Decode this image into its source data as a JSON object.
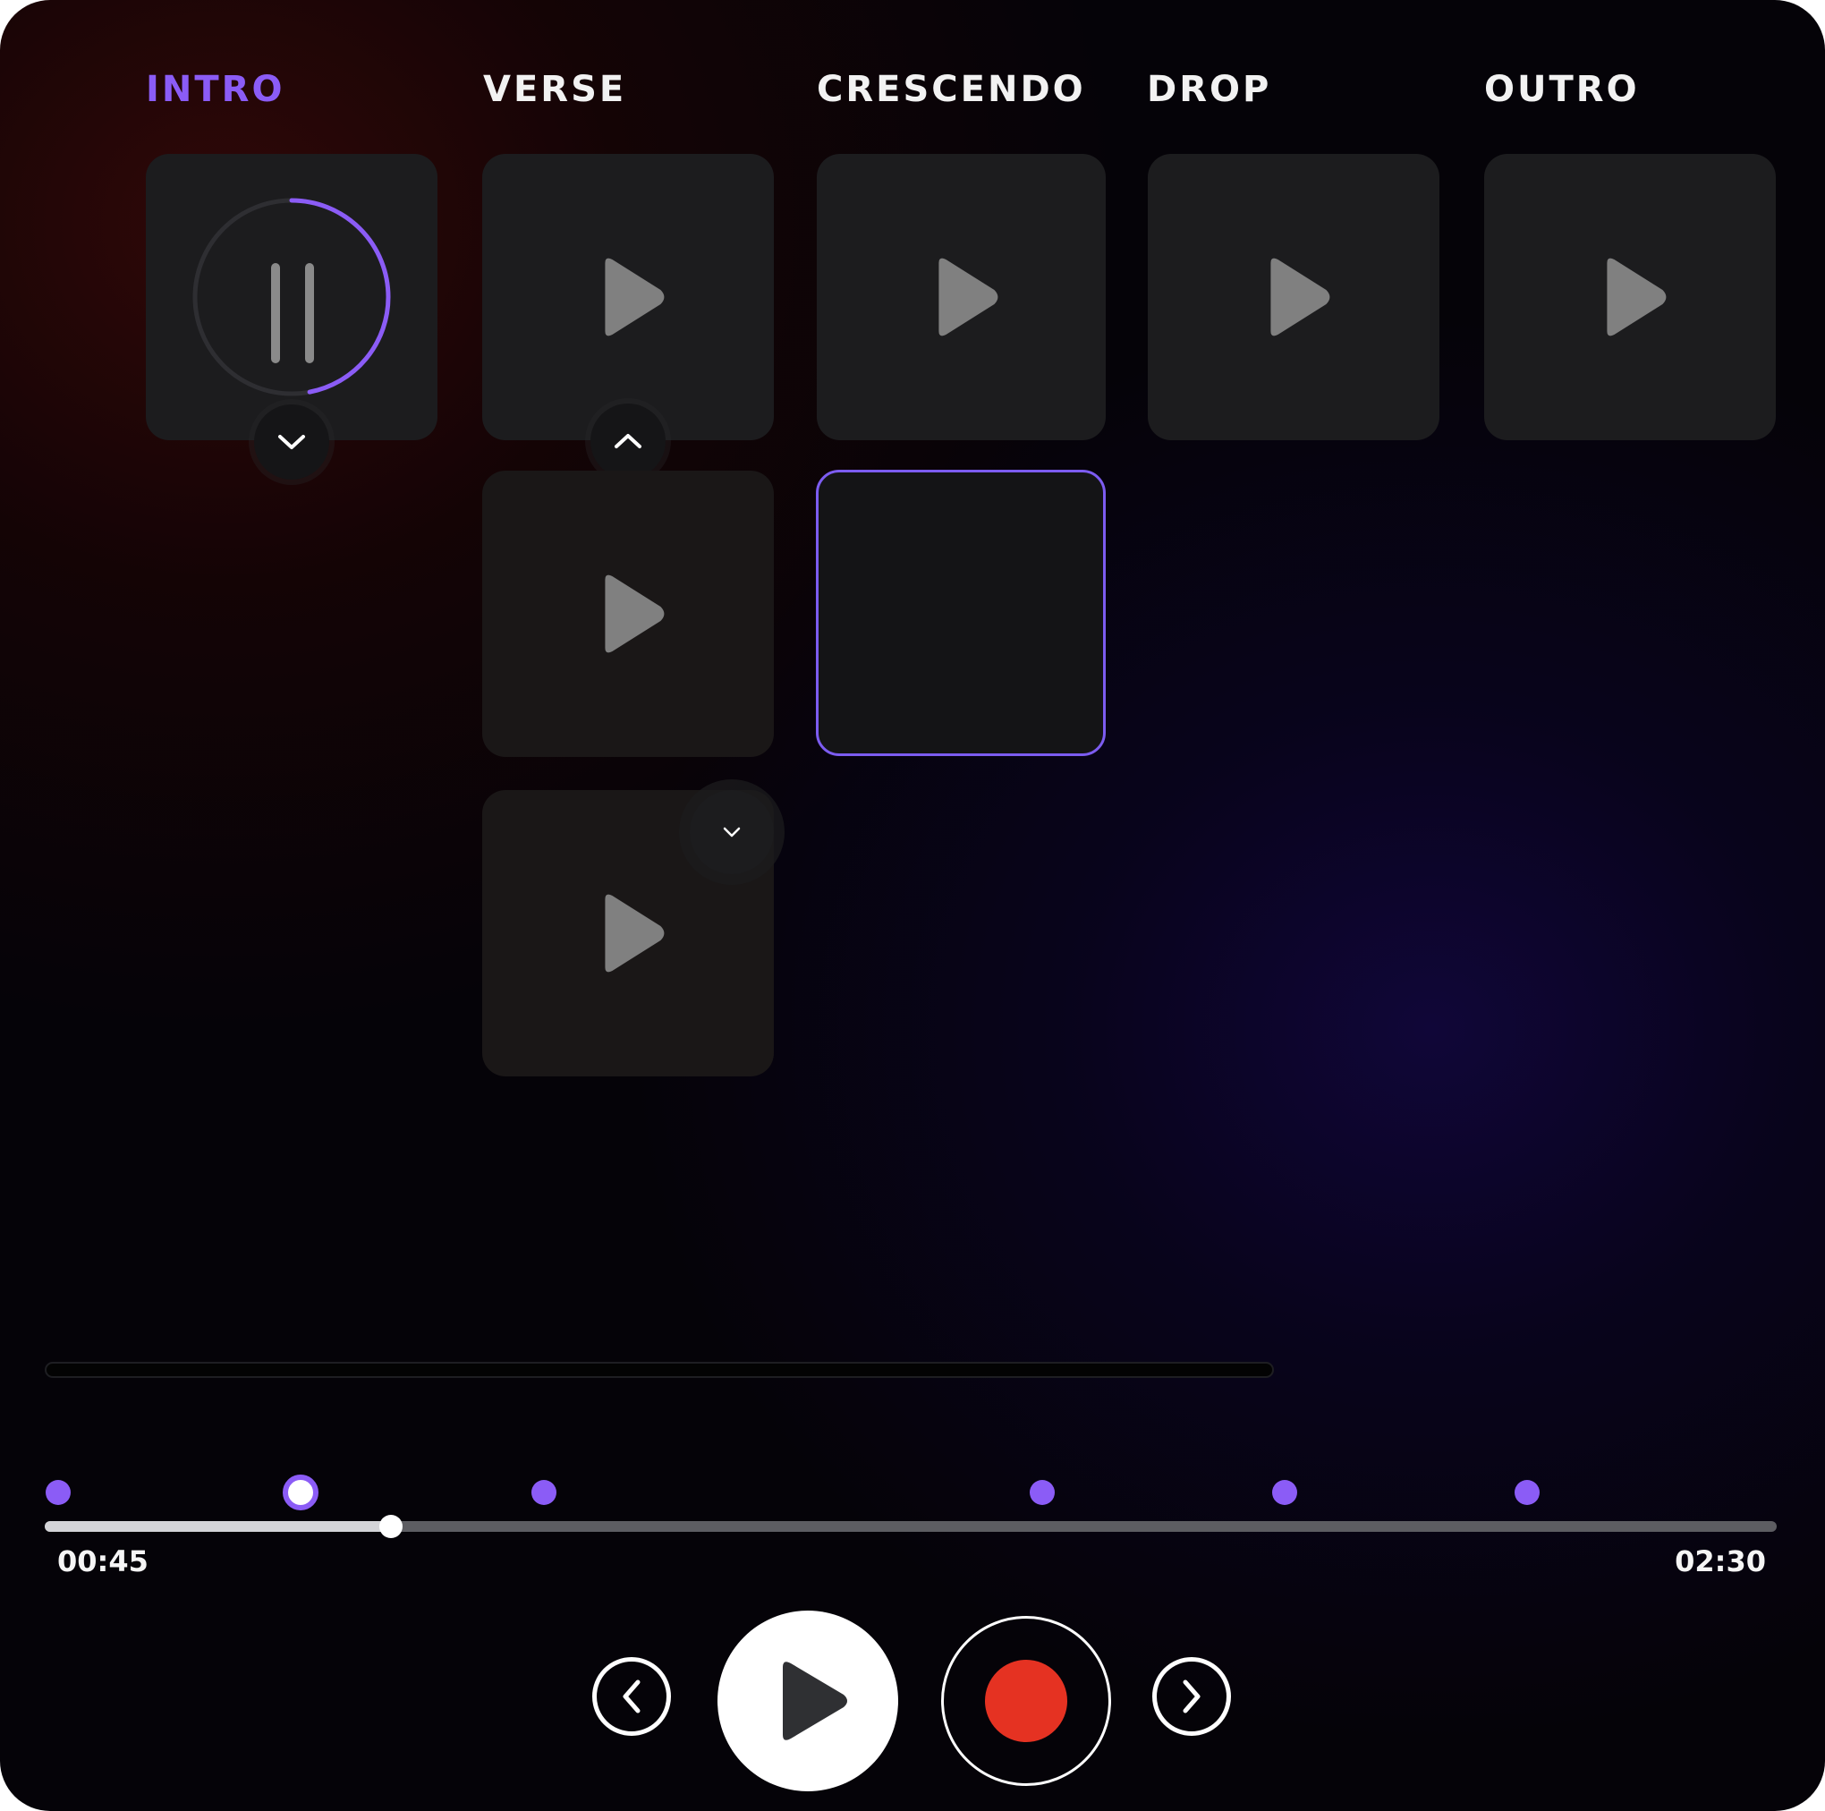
{
  "sections": [
    {
      "label": "INTRO",
      "state": "playing"
    },
    {
      "label": "VERSE",
      "state": "idle"
    },
    {
      "label": "CRESCENDO",
      "state": "idle"
    },
    {
      "label": "DROP",
      "state": "idle"
    },
    {
      "label": "OUTRO",
      "state": "idle"
    }
  ],
  "intro_loop_progress": 0.47,
  "colors": {
    "accent": "#8b5cf6",
    "record": "#e53222",
    "tile": "#1c1c1e",
    "icon": "#808080"
  },
  "icons": {
    "tile_play": "play-triangle-icon",
    "pause": "pause-icon",
    "expand": "chevron-down-icon",
    "collapse": "chevron-up-icon",
    "prev": "chevron-left-icon",
    "next": "chevron-right-icon",
    "record": "record-dot-icon"
  },
  "timeline": {
    "current_time": "00:45",
    "total_time": "02:30",
    "progress": 0.2,
    "section_markers_count": 6,
    "current_marker_index": 1
  }
}
